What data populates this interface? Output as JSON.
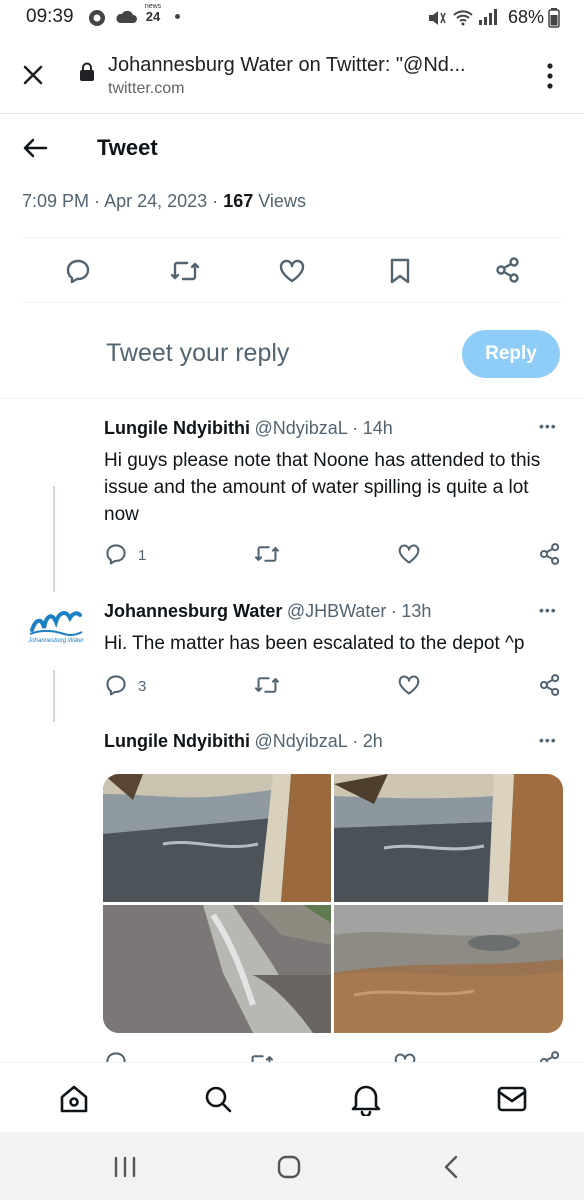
{
  "status_bar": {
    "time": "09:39",
    "news_badge_top": "news",
    "news_badge_bottom": "24",
    "battery": "68%"
  },
  "browser": {
    "title": "Johannesburg Water on Twitter: \"@Nd...",
    "url": "twitter.com"
  },
  "header": {
    "title": "Tweet"
  },
  "tweet_meta": {
    "time": "7:09 PM",
    "date": "Apr 24, 2023",
    "separator": "·",
    "views_count": "167",
    "views_label": "Views"
  },
  "reply_box": {
    "placeholder": "Tweet your reply",
    "button": "Reply"
  },
  "replies": [
    {
      "name": "Lungile Ndyibithi",
      "handle": "@NdyibzaL",
      "time": "14h",
      "text": "Hi guys please note that Noone has attended to this issue and the amount of water spilling is quite a lot now",
      "reply_count": "1"
    },
    {
      "name": "Johannesburg Water",
      "handle": "@JHBWater",
      "time": "13h",
      "text": "Hi. The matter has been escalated to the depot ^p",
      "reply_count": "3",
      "avatar_caption": "Johannesburg Water"
    },
    {
      "name": "Lungile Ndyibithi",
      "handle": "@NdyibzaL",
      "time": "2h"
    }
  ],
  "more_label": "•••",
  "colors": {
    "accent_disabled": "#8ecdf8",
    "text": "#0f1419",
    "secondary": "#536471",
    "logo_blue": "#1d7fc4"
  }
}
